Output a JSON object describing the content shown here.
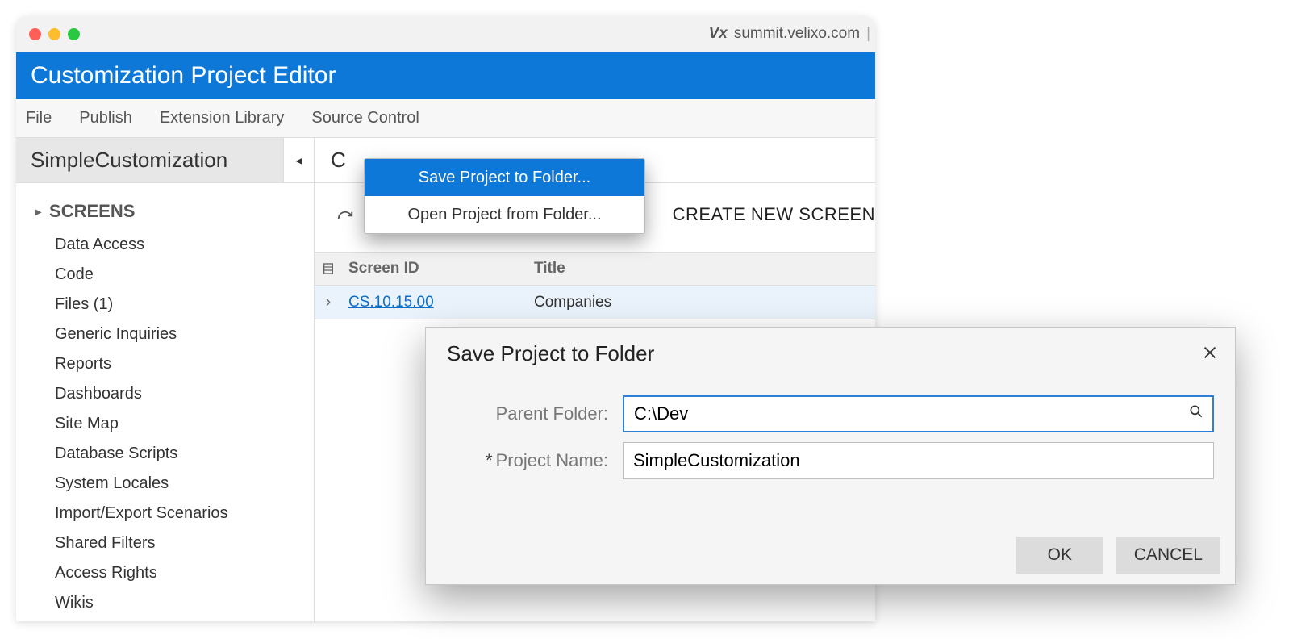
{
  "browser": {
    "vx_label": "Vx",
    "url": "summit.velixo.com"
  },
  "header_title": "Customization Project Editor",
  "menubar": {
    "file": "File",
    "publish": "Publish",
    "extension_library": "Extension Library",
    "source_control": "Source Control"
  },
  "project_name": "SimpleCustomization",
  "subheader_partial": "C",
  "sidebar": {
    "heading": "SCREENS",
    "items": [
      "Data Access",
      "Code",
      "Files (1)",
      "Generic Inquiries",
      "Reports",
      "Dashboards",
      "Site Map",
      "Database Scripts",
      "System Locales",
      "Import/Export Scenarios",
      "Shared Filters",
      "Access Rights",
      "Wikis"
    ]
  },
  "toolbar": {
    "create_new": "CREATE NEW SCREEN"
  },
  "table": {
    "headers": {
      "screen_id": "Screen ID",
      "title": "Title"
    },
    "rows": [
      {
        "screen_id": "CS.10.15.00",
        "title": "Companies"
      }
    ]
  },
  "dropdown": {
    "save_to_folder": "Save Project to Folder...",
    "open_from_folder": "Open Project from Folder..."
  },
  "dialog": {
    "title": "Save Project to Folder",
    "parent_folder_label": "Parent Folder:",
    "parent_folder_value": "C:\\Dev",
    "project_name_label": "Project Name:",
    "project_name_value": "SimpleCustomization",
    "ok": "OK",
    "cancel": "CANCEL"
  }
}
